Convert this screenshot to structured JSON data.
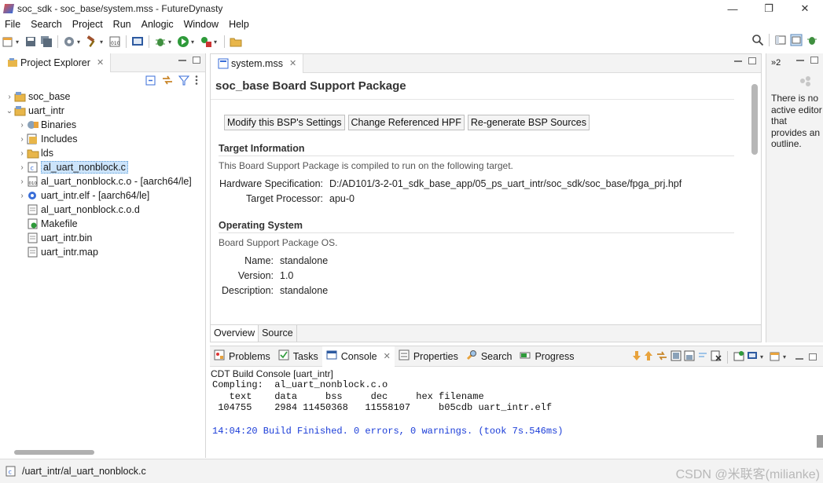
{
  "window": {
    "title": "soc_sdk - soc_base/system.mss - FutureDynasty",
    "minimize": "—",
    "restore": "❐",
    "close": "✕"
  },
  "menu": [
    "File",
    "Search",
    "Project",
    "Run",
    "Anlogic",
    "Window",
    "Help"
  ],
  "project_explorer": {
    "tab_label": "Project Explorer",
    "tree": [
      {
        "label": "soc_base",
        "twisty": "›",
        "icon": "project-icon",
        "indent": 0
      },
      {
        "label": "uart_intr",
        "twisty": "⌄",
        "icon": "project-icon",
        "indent": 0
      },
      {
        "label": "Binaries",
        "twisty": "›",
        "icon": "binaries-icon",
        "indent": 1
      },
      {
        "label": "Includes",
        "twisty": "›",
        "icon": "includes-icon",
        "indent": 1
      },
      {
        "label": "lds",
        "twisty": "›",
        "icon": "folder-icon",
        "indent": 1
      },
      {
        "label": "al_uart_nonblock.c",
        "twisty": "›",
        "icon": "c-file-icon",
        "indent": 1,
        "selected": true
      },
      {
        "label": "al_uart_nonblock.c.o - [aarch64/le]",
        "twisty": "›",
        "icon": "object-file-icon",
        "indent": 1
      },
      {
        "label": "uart_intr.elf - [aarch64/le]",
        "twisty": "›",
        "icon": "elf-file-icon",
        "indent": 1
      },
      {
        "label": "al_uart_nonblock.c.o.d",
        "twisty": "",
        "icon": "file-icon",
        "indent": 1
      },
      {
        "label": "Makefile",
        "twisty": "",
        "icon": "makefile-icon",
        "indent": 1
      },
      {
        "label": "uart_intr.bin",
        "twisty": "",
        "icon": "file-icon",
        "indent": 1
      },
      {
        "label": "uart_intr.map",
        "twisty": "",
        "icon": "file-icon",
        "indent": 1
      }
    ]
  },
  "editor": {
    "tab_label": "system.mss",
    "title": "soc_base Board Support Package",
    "buttons": [
      "Modify this BSP's Settings",
      "Change Referenced HPF",
      "Re-generate BSP Sources"
    ],
    "target": {
      "heading": "Target Information",
      "description": "This Board Support Package is compiled to run on the following target.",
      "hw_label": "Hardware Specification:",
      "hw_value": "D:/AD101/3-2-01_sdk_base_app/05_ps_uart_intr/soc_sdk/soc_base/fpga_prj.hpf",
      "proc_label": "Target Processor:",
      "proc_value": "apu-0"
    },
    "os": {
      "heading": "Operating System",
      "description": "Board Support Package OS.",
      "name_label": "Name:",
      "name_value": "standalone",
      "version_label": "Version:",
      "version_value": "1.0",
      "desc_label": "Description:",
      "desc_value": "standalone"
    },
    "bottom_tabs": [
      "Overview",
      "Source"
    ]
  },
  "outline": {
    "tab_label": "»2",
    "message": "There is no active editor that provides an outline."
  },
  "console": {
    "tabs": [
      {
        "label": "Problems",
        "icon": "problems-icon"
      },
      {
        "label": "Tasks",
        "icon": "tasks-icon"
      },
      {
        "label": "Console",
        "icon": "console-icon",
        "active": true
      },
      {
        "label": "Properties",
        "icon": "properties-icon"
      },
      {
        "label": "Search",
        "icon": "search-icon"
      },
      {
        "label": "Progress",
        "icon": "progress-icon"
      }
    ],
    "title": "CDT Build Console [uart_intr]",
    "lines": [
      "Compling:  al_uart_nonblock.c.o",
      "   text    data     bss     dec     hex filename",
      " 104755    2984 11450368   11558107     b05cdb uart_intr.elf"
    ],
    "finish": "14:04:20 Build Finished. 0 errors, 0 warnings. (took 7s.546ms)"
  },
  "status": {
    "path": "/uart_intr/al_uart_nonblock.c",
    "watermark": "CSDN @米联客(milianke)"
  },
  "colors": {
    "selection": "#cce4fb",
    "console_finish": "#1a3cd8",
    "panel_bg": "#f3f3f3"
  }
}
